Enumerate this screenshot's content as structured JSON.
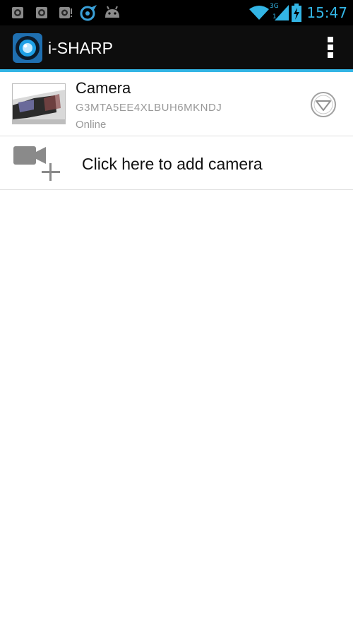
{
  "status_bar": {
    "time": "15:47",
    "network_type": "3G",
    "signal_slot": "1",
    "notification_icons": [
      "camera-notification-icon",
      "camera-notification-icon",
      "camera-alert-notification-icon",
      "bird-notification-icon",
      "android-debug-icon"
    ],
    "status_icons": [
      "wifi-icon",
      "cell-signal-icon",
      "battery-charging-icon"
    ]
  },
  "action_bar": {
    "title": "i-SHARP",
    "logo_icon": "camera-lens-icon",
    "menu_icon": "overflow-menu-icon"
  },
  "camera_list": [
    {
      "name": "Camera",
      "uid": "G3MTA5EE4XLBUH6MKNDJ",
      "status": "Online",
      "options_icon": "chevron-down-circle-icon"
    }
  ],
  "add_camera": {
    "label": "Click here to add camera",
    "icon": "add-video-camera-icon"
  },
  "colors": {
    "accent": "#33b5e5",
    "action_bar_bg": "#0d0d0d",
    "status_bar_bg": "#000000",
    "secondary_text": "#999999"
  }
}
